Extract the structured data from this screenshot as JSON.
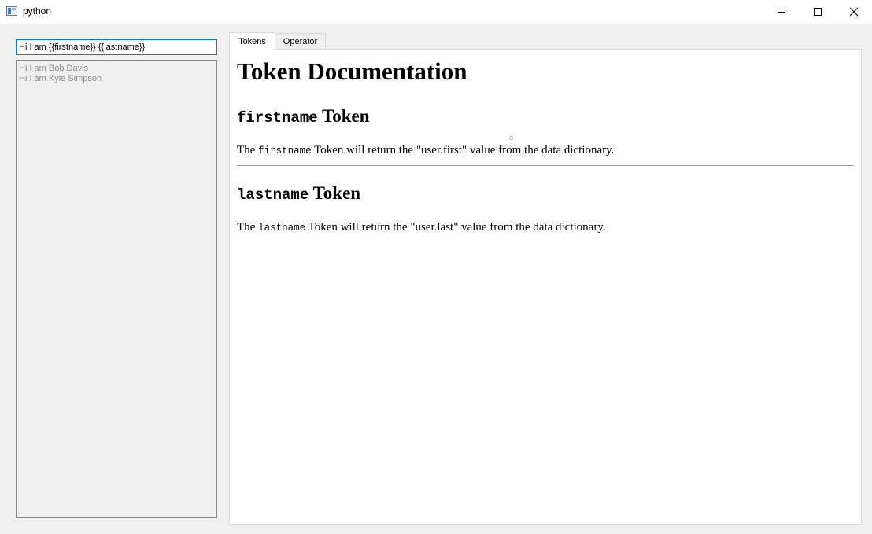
{
  "window": {
    "title": "python",
    "icon": "python-app-icon",
    "controls": [
      "minimize-icon",
      "maximize-icon",
      "close-icon"
    ]
  },
  "template_input": {
    "value": "Hi I am {{firstname}} {{lastname}}"
  },
  "results": {
    "items": [
      "Hi I am Bob Davis",
      "Hi I am Kyle Simpson"
    ]
  },
  "tabs": [
    {
      "label": "Tokens",
      "selected": true
    },
    {
      "label": "Operator",
      "selected": false
    }
  ],
  "doc": {
    "title": "Token Documentation",
    "sections": [
      {
        "token": "firstname",
        "heading_suffix": "Token",
        "desc_prefix": "The",
        "desc_token": "firstname",
        "desc_rest": "Token will return the \"user.first\" value from the data dictionary."
      },
      {
        "token": "lastname",
        "heading_suffix": "Token",
        "desc_prefix": "The",
        "desc_token": "lastname",
        "desc_rest": "Token will return the \"user.last\" value from the data dictionary."
      }
    ]
  },
  "colors": {
    "focus_border": "#0078d7",
    "window_bg": "#f0f0f0",
    "muted_text": "#8a8a8a"
  }
}
